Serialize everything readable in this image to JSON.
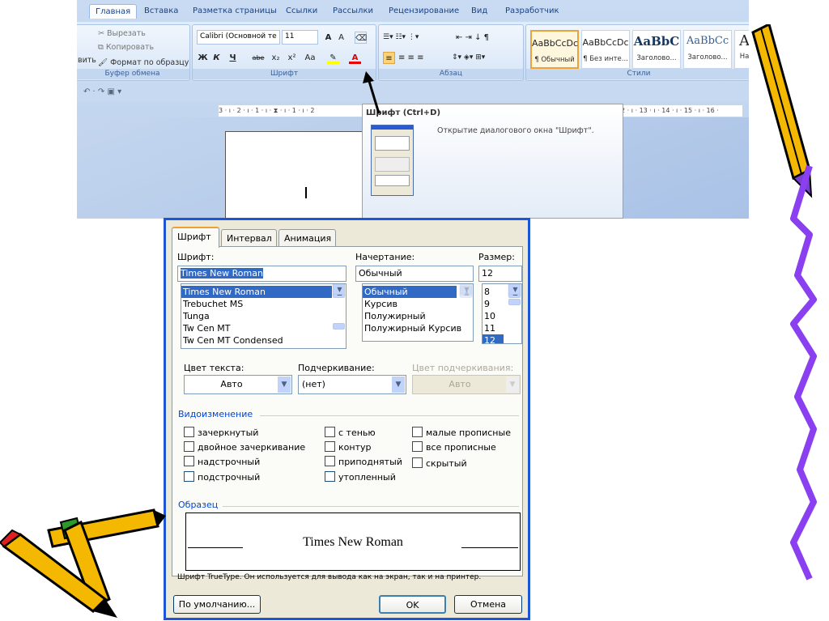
{
  "ribbon": {
    "tabs": [
      "Главная",
      "Вставка",
      "Разметка страницы",
      "Ссылки",
      "Рассылки",
      "Рецензирование",
      "Вид",
      "Разработчик"
    ],
    "clipboard": {
      "paste": "вить",
      "cut": "Вырезать",
      "copy": "Копировать",
      "format_painter": "Формат по образцу",
      "label": "Буфер обмена"
    },
    "font": {
      "name": "Calibri (Основной те",
      "size": "11",
      "label": "Шрифт",
      "bold": "Ж",
      "italic": "К",
      "underline": "Ч",
      "strike": "abe",
      "sub": "x₂",
      "sup": "x²",
      "case": "Aa"
    },
    "paragraph": {
      "label": "Абзац"
    },
    "styles": {
      "label": "Стили",
      "items": [
        {
          "preview": "AaBbCcDc",
          "name": "¶ Обычный"
        },
        {
          "preview": "AaBbCcDc",
          "name": "¶ Без инте..."
        },
        {
          "preview": "AaBbC",
          "name": "Заголово..."
        },
        {
          "preview": "AaBbCc",
          "name": "Заголово..."
        },
        {
          "preview": "A",
          "name": "На"
        }
      ]
    }
  },
  "ruler": {
    "left": "3 · ı · 2 · ı · 1 · ı · ⧗ · ı · 1 · ı · 2",
    "right": "2 · ı · 13 · ı · 14 · ı · 15 · ı · 16 ·"
  },
  "tooltip": {
    "title": "Шрифт (Ctrl+D)",
    "text": "Открытие диалогового окна \"Шрифт\"."
  },
  "dialog": {
    "tabs": [
      "Шрифт",
      "Интервал",
      "Анимация"
    ],
    "font_label": "Шрифт:",
    "font_value": "Times New Roman",
    "fonts": [
      "Times New Roman",
      "Trebuchet MS",
      "Tunga",
      "Tw Cen MT",
      "Tw Cen MT Condensed"
    ],
    "style_label": "Начертание:",
    "style_value": "Обычный",
    "styles": [
      "Обычный",
      "Курсив",
      "Полужирный",
      "Полужирный Курсив"
    ],
    "size_label": "Размер:",
    "size_value": "12",
    "sizes": [
      "8",
      "9",
      "10",
      "11",
      "12"
    ],
    "color_label": "Цвет текста:",
    "color_value": "Авто",
    "underline_label": "Подчеркивание:",
    "underline_value": "(нет)",
    "underline_color_label": "Цвет подчеркивания:",
    "underline_color_value": "Авто",
    "effects_label": "Видоизменение",
    "effects": [
      "зачеркнутый",
      "двойное зачеркивание",
      "надстрочный",
      "подстрочный",
      "с тенью",
      "контур",
      "приподнятый",
      "утопленный",
      "малые прописные",
      "все прописные",
      "скрытый"
    ],
    "preview_label": "Образец",
    "preview_text": "Times New Roman",
    "note": "Шрифт TrueType. Он используется для вывода как на экран, так и на принтер.",
    "default_button": "По умолчанию...",
    "ok_button": "OK",
    "cancel_button": "Отмена"
  }
}
